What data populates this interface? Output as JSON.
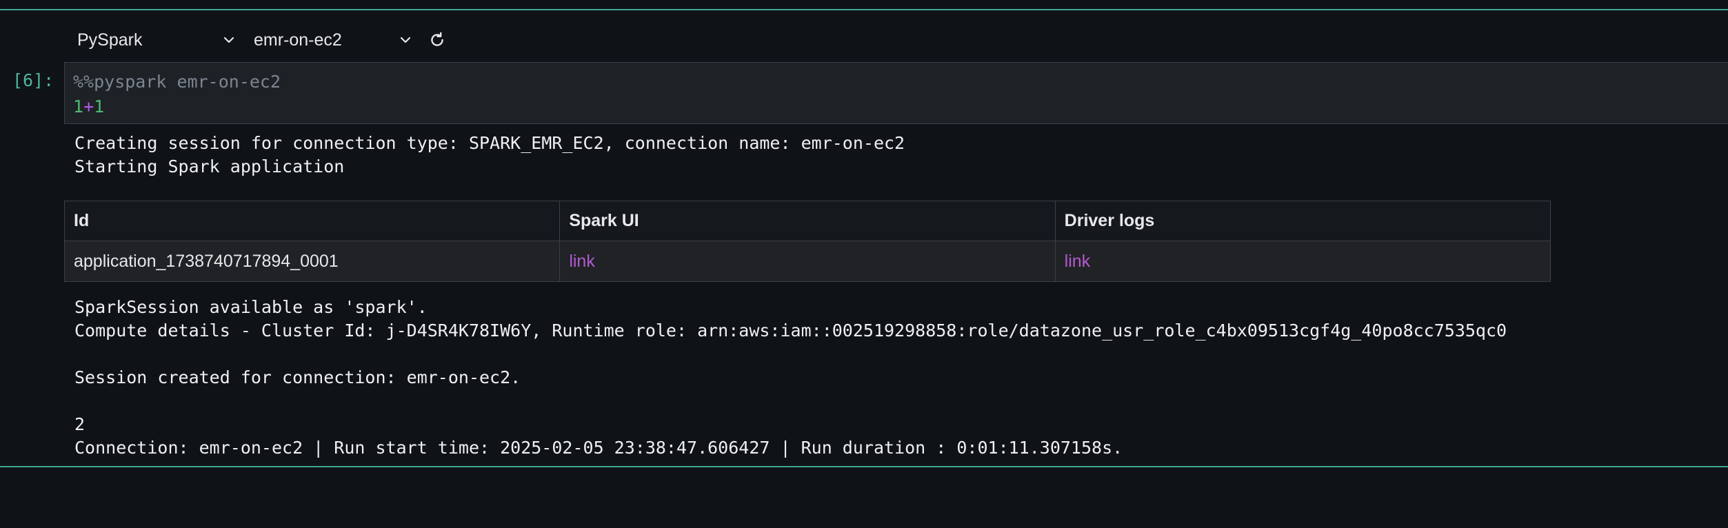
{
  "toolbar": {
    "kernel_select": "PySpark",
    "connection_select": "emr-on-ec2"
  },
  "cell": {
    "prompt": "[6]:",
    "code_magic": "%%pyspark emr-on-ec2",
    "code_left": "1",
    "code_op": "+",
    "code_right": "1"
  },
  "output": {
    "creating_line": "Creating session for connection type: SPARK_EMR_EC2, connection name: emr-on-ec2",
    "starting_line": "Starting Spark application",
    "table": {
      "headers": [
        "Id",
        "Spark UI",
        "Driver logs"
      ],
      "row": [
        "application_1738740717894_0001",
        "link",
        "link"
      ]
    },
    "spark_available_line": "SparkSession available as 'spark'.",
    "compute_details_line": "Compute details - Cluster Id: j-D4SR4K78IW6Y, Runtime role: arn:aws:iam::002519298858:role/datazone_usr_role_c4bx09513cgf4g_40po8cc7535qc0",
    "session_created_line": "Session created for connection: emr-on-ec2.",
    "result_line": "2",
    "connection_info_line": "Connection: emr-on-ec2 | Run start time: 2025-02-05 23:38:47.606427 | Run duration : 0:01:11.307158s."
  },
  "colors": {
    "background": "#0f1216",
    "cell_border": "#3fa893",
    "link": "#b45ad2",
    "prompt": "#4fb59c"
  },
  "icons": {
    "kernel_dropdown": "chevron-down-icon",
    "connection_dropdown": "chevron-down-icon",
    "refresh": "refresh-icon"
  }
}
